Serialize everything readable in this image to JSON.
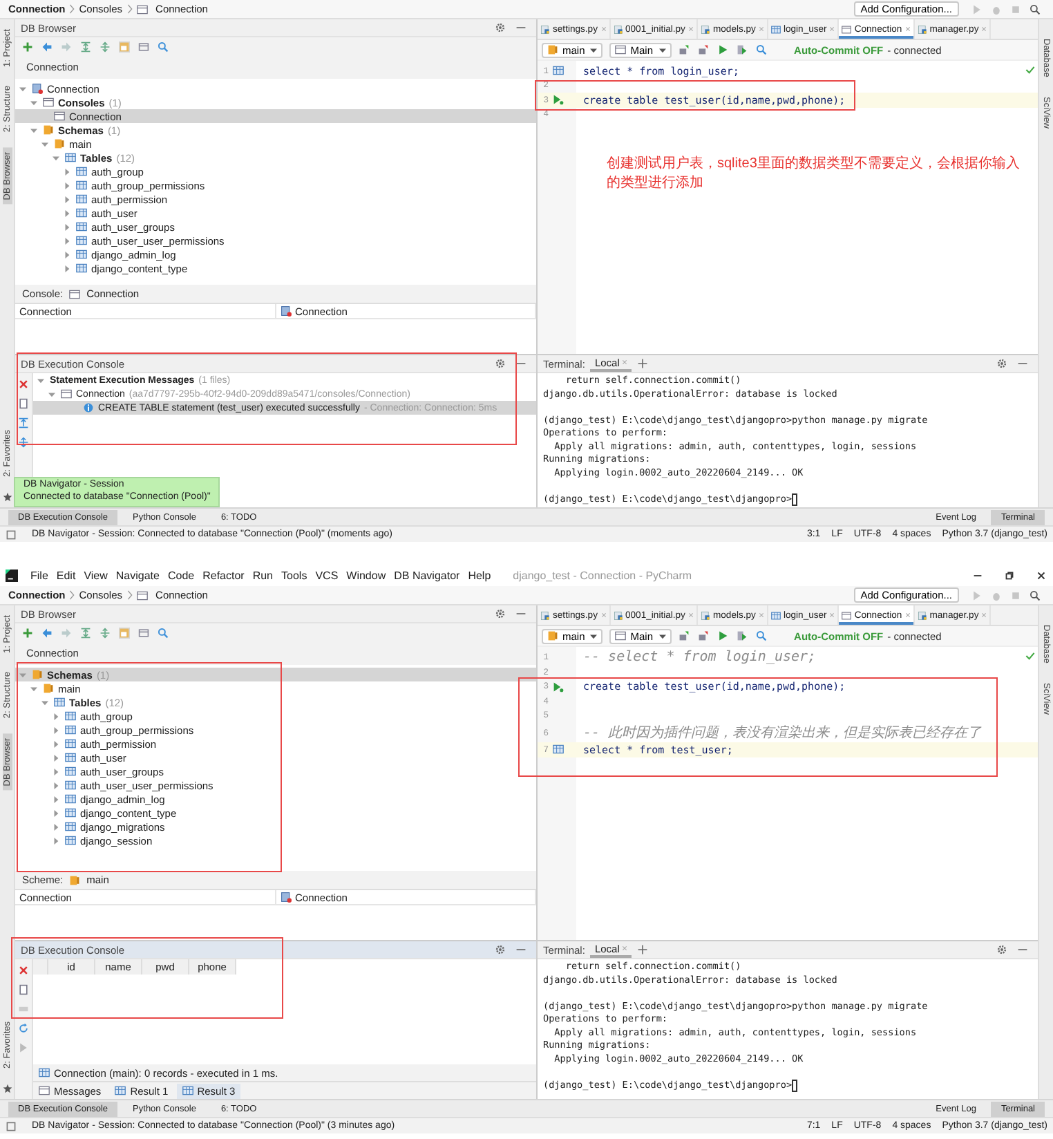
{
  "shots": [
    {
      "breadcrumb": [
        "Connection",
        "Consoles",
        "Connection"
      ],
      "add_configuration": "Add Configuration...",
      "left_tabs": [
        {
          "label": "1: Project",
          "selected": false
        },
        {
          "label": "2: Structure",
          "selected": false
        },
        {
          "label": "DB Browser",
          "selected": true
        }
      ],
      "favorites_tab": "2: Favorites",
      "right_tabs": [
        "Database",
        "SciView"
      ],
      "db_browser": {
        "title": "DB Browser",
        "connection_label": "Connection",
        "tree": [
          {
            "kind": "connection",
            "label": "Connection",
            "expanded": true,
            "selected": false,
            "children": [
              {
                "kind": "consoles",
                "label": "Consoles",
                "count": "(1)",
                "expanded": true,
                "selected": false,
                "children": [
                  {
                    "kind": "console",
                    "label": "Connection",
                    "selected": true
                  }
                ]
              },
              {
                "kind": "schemas",
                "label": "Schemas",
                "count": "(1)",
                "expanded": true,
                "selected": false,
                "children": [
                  {
                    "kind": "schema",
                    "label": "main",
                    "expanded": true,
                    "selected": false,
                    "children": [
                      {
                        "kind": "tables",
                        "label": "Tables",
                        "count": "(12)",
                        "expanded": true,
                        "selected": false,
                        "children": [
                          {
                            "kind": "table",
                            "label": "auth_group",
                            "expanded": false,
                            "selected": false
                          },
                          {
                            "kind": "table",
                            "label": "auth_group_permissions",
                            "expanded": false,
                            "selected": false
                          },
                          {
                            "kind": "table",
                            "label": "auth_permission",
                            "expanded": false,
                            "selected": false
                          },
                          {
                            "kind": "table",
                            "label": "auth_user",
                            "expanded": false,
                            "selected": false
                          },
                          {
                            "kind": "table",
                            "label": "auth_user_groups",
                            "expanded": false,
                            "selected": false
                          },
                          {
                            "kind": "table",
                            "label": "auth_user_user_permissions",
                            "expanded": false,
                            "selected": false
                          },
                          {
                            "kind": "table",
                            "label": "django_admin_log",
                            "expanded": false,
                            "selected": false
                          },
                          {
                            "kind": "table",
                            "label": "django_content_type",
                            "expanded": false,
                            "selected": false
                          }
                        ]
                      }
                    ]
                  }
                ]
              }
            ]
          }
        ],
        "footer": {
          "label": "Console:",
          "kind": "console",
          "value": "Connection"
        },
        "table": [
          "Connection",
          "Connection"
        ]
      },
      "editor": {
        "tabs": [
          {
            "label": "settings.py",
            "kind": "python",
            "selected": false
          },
          {
            "label": "0001_initial.py",
            "kind": "python",
            "selected": false
          },
          {
            "label": "models.py",
            "kind": "python",
            "selected": false
          },
          {
            "label": "login_user",
            "kind": "table",
            "selected": false
          },
          {
            "label": "Connection",
            "kind": "console",
            "selected": true
          },
          {
            "label": "manager.py",
            "kind": "python",
            "selected": false
          }
        ],
        "schema": "main",
        "console": "Main",
        "autocommit": "Auto-Commit OFF",
        "status": "- connected",
        "lines": [
          {
            "number": "1",
            "marker": {
              "kind": "table"
            },
            "kind": "code",
            "text": "select * from login_user;",
            "current": false
          },
          {
            "number": "2",
            "current": false
          },
          {
            "number": "3",
            "marker": {
              "kind": "run"
            },
            "kind": "code",
            "text": "create table test_user(id,name,pwd,phone);",
            "current": true
          },
          {
            "number": "4",
            "current": false
          }
        ],
        "note": "创建测试用户表，sqlite3里面的数据类型不需要定义，会根据你输入的类型进行添加"
      },
      "exec_console": {
        "title": "DB Execution Console",
        "kind": "messages",
        "selected": false,
        "messages": {
          "label": "Statement Execution Messages",
          "count": "(1 files)",
          "connection": "Connection",
          "path": "(aa7d7797-295b-40f2-94d0-209dd89a5471/consoles/Connection)",
          "entries": [
            {
              "text": "CREATE TABLE statement (test_user) executed successfully",
              "detail": "- Connection: Connection: 5ms",
              "selected": true
            }
          ]
        }
      },
      "terminal": {
        "label": "Terminal:",
        "tab": "Local",
        "lines": [
          {
            "kind": "output",
            "text": "    return self.connection.commit()"
          },
          {
            "kind": "output",
            "text": "django.db.utils.OperationalError: database is locked"
          },
          {
            "kind": "blank"
          },
          {
            "kind": "output",
            "text": "(django_test) E:\\code\\django_test\\djangopro>python manage.py migrate"
          },
          {
            "kind": "output",
            "text": "Operations to perform:"
          },
          {
            "kind": "output",
            "text": "  Apply all migrations: admin, auth, contenttypes, login, sessions"
          },
          {
            "kind": "output",
            "text": "Running migrations:"
          },
          {
            "kind": "output",
            "text": "  Applying login.0002_auto_20220604_2149... OK"
          },
          {
            "kind": "blank"
          },
          {
            "kind": "prompt",
            "text": "(django_test) E:\\code\\django_test\\djangopro>"
          }
        ]
      },
      "tool_tabs": [
        {
          "label": "DB Execution Console",
          "selected": true
        },
        {
          "label": "Python Console",
          "selected": false
        },
        {
          "label": "6: TODO",
          "selected": false
        }
      ],
      "tool_tabs_right": [
        {
          "label": "Event Log",
          "selected": false
        },
        {
          "label": "Terminal",
          "selected": true
        }
      ],
      "status": "DB Navigator - Session: Connected to database \"Connection (Pool)\" (moments ago)",
      "status_right": [
        "3:1",
        "LF",
        "UTF-8",
        "4 spaces",
        "Python 3.7 (django_test)"
      ],
      "tooltip": {
        "title": "DB Navigator - Session",
        "text": "Connected to database \"Connection (Pool)\""
      }
    },
    {
      "menu": [
        "File",
        "Edit",
        "View",
        "Navigate",
        "Code",
        "Refactor",
        "Run",
        "Tools",
        "VCS",
        "Window",
        "DB Navigator",
        "Help"
      ],
      "window_title": "django_test - Connection - PyCharm",
      "breadcrumb": [
        "Connection",
        "Consoles",
        "Connection"
      ],
      "add_configuration": "Add Configuration...",
      "left_tabs": [
        {
          "label": "1: Project",
          "selected": false
        },
        {
          "label": "2: Structure",
          "selected": false
        },
        {
          "label": "DB Browser",
          "selected": true
        }
      ],
      "favorites_tab": "2: Favorites",
      "right_tabs": [
        "Database",
        "SciView"
      ],
      "db_browser": {
        "title": "DB Browser",
        "connection_label": "Connection",
        "tree": [
          {
            "kind": "schemas",
            "label": "Schemas",
            "count": "(1)",
            "expanded": true,
            "selected": true,
            "children": [
              {
                "kind": "schema",
                "label": "main",
                "expanded": true,
                "selected": false,
                "children": [
                  {
                    "kind": "tables",
                    "label": "Tables",
                    "count": "(12)",
                    "expanded": true,
                    "selected": false,
                    "children": [
                      {
                        "kind": "table",
                        "label": "auth_group",
                        "expanded": false,
                        "selected": false
                      },
                      {
                        "kind": "table",
                        "label": "auth_group_permissions",
                        "expanded": false,
                        "selected": false
                      },
                      {
                        "kind": "table",
                        "label": "auth_permission",
                        "expanded": false,
                        "selected": false
                      },
                      {
                        "kind": "table",
                        "label": "auth_user",
                        "expanded": false,
                        "selected": false
                      },
                      {
                        "kind": "table",
                        "label": "auth_user_groups",
                        "expanded": false,
                        "selected": false
                      },
                      {
                        "kind": "table",
                        "label": "auth_user_user_permissions",
                        "expanded": false,
                        "selected": false
                      },
                      {
                        "kind": "table",
                        "label": "django_admin_log",
                        "expanded": false,
                        "selected": false
                      },
                      {
                        "kind": "table",
                        "label": "django_content_type",
                        "expanded": false,
                        "selected": false
                      },
                      {
                        "kind": "table",
                        "label": "django_migrations",
                        "expanded": false,
                        "selected": false
                      },
                      {
                        "kind": "table",
                        "label": "django_session",
                        "expanded": false,
                        "selected": false
                      }
                    ]
                  }
                ]
              }
            ]
          }
        ],
        "footer": {
          "label": "Scheme:",
          "kind": "schema",
          "value": "main"
        },
        "table": [
          "Connection",
          "Connection"
        ]
      },
      "editor": {
        "tabs": [
          {
            "label": "settings.py",
            "kind": "python",
            "selected": false
          },
          {
            "label": "0001_initial.py",
            "kind": "python",
            "selected": false
          },
          {
            "label": "models.py",
            "kind": "python",
            "selected": false
          },
          {
            "label": "login_user",
            "kind": "table",
            "selected": false
          },
          {
            "label": "Connection",
            "kind": "console",
            "selected": true
          },
          {
            "label": "manager.py",
            "kind": "python",
            "selected": false
          }
        ],
        "schema": "main",
        "console": "Main",
        "autocommit": "Auto-Commit OFF",
        "status": "- connected",
        "lines": [
          {
            "number": "1",
            "kind": "comment",
            "text": "-- select * from login_user;",
            "current": false
          },
          {
            "number": "2",
            "current": false
          },
          {
            "number": "3",
            "marker": {
              "kind": "run"
            },
            "kind": "code",
            "text": "create table test_user(id,name,pwd,phone);",
            "current": false
          },
          {
            "number": "4",
            "current": false
          },
          {
            "number": "5",
            "current": false
          },
          {
            "number": "6",
            "kind": "comment",
            "text": "-- 此时因为插件问题，表没有渲染出来，但是实际表已经存在了",
            "current": false
          },
          {
            "number": "7",
            "marker": {
              "kind": "table"
            },
            "kind": "code",
            "text": "select * from test_user;",
            "current": true
          }
        ]
      },
      "exec_console": {
        "title": "DB Execution Console",
        "kind": "result",
        "selected": true,
        "columns": [
          "id",
          "name",
          "pwd",
          "phone"
        ],
        "summary": "Connection (main): 0 records   - executed in 1 ms.",
        "result_tabs": [
          {
            "label": "Messages",
            "selected": false
          },
          {
            "label": "Result 1",
            "selected": false
          },
          {
            "label": "Result 3",
            "selected": true
          }
        ]
      },
      "terminal": {
        "label": "Terminal:",
        "tab": "Local",
        "lines": [
          {
            "kind": "output",
            "text": "    return self.connection.commit()"
          },
          {
            "kind": "output",
            "text": "django.db.utils.OperationalError: database is locked"
          },
          {
            "kind": "blank"
          },
          {
            "kind": "output",
            "text": "(django_test) E:\\code\\django_test\\djangopro>python manage.py migrate"
          },
          {
            "kind": "output",
            "text": "Operations to perform:"
          },
          {
            "kind": "output",
            "text": "  Apply all migrations: admin, auth, contenttypes, login, sessions"
          },
          {
            "kind": "output",
            "text": "Running migrations:"
          },
          {
            "kind": "output",
            "text": "  Applying login.0002_auto_20220604_2149... OK"
          },
          {
            "kind": "blank"
          },
          {
            "kind": "prompt",
            "text": "(django_test) E:\\code\\django_test\\djangopro>"
          }
        ]
      },
      "tool_tabs": [
        {
          "label": "DB Execution Console",
          "selected": true
        },
        {
          "label": "Python Console",
          "selected": false
        },
        {
          "label": "6: TODO",
          "selected": false
        }
      ],
      "tool_tabs_right": [
        {
          "label": "Event Log",
          "selected": false
        },
        {
          "label": "Terminal",
          "selected": true
        }
      ],
      "status": "DB Navigator - Session: Connected to database \"Connection (Pool)\" (3 minutes ago)",
      "status_right": [
        "7:1",
        "LF",
        "UTF-8",
        "4 spaces",
        "Python 3.7 (django_test)"
      ]
    }
  ]
}
